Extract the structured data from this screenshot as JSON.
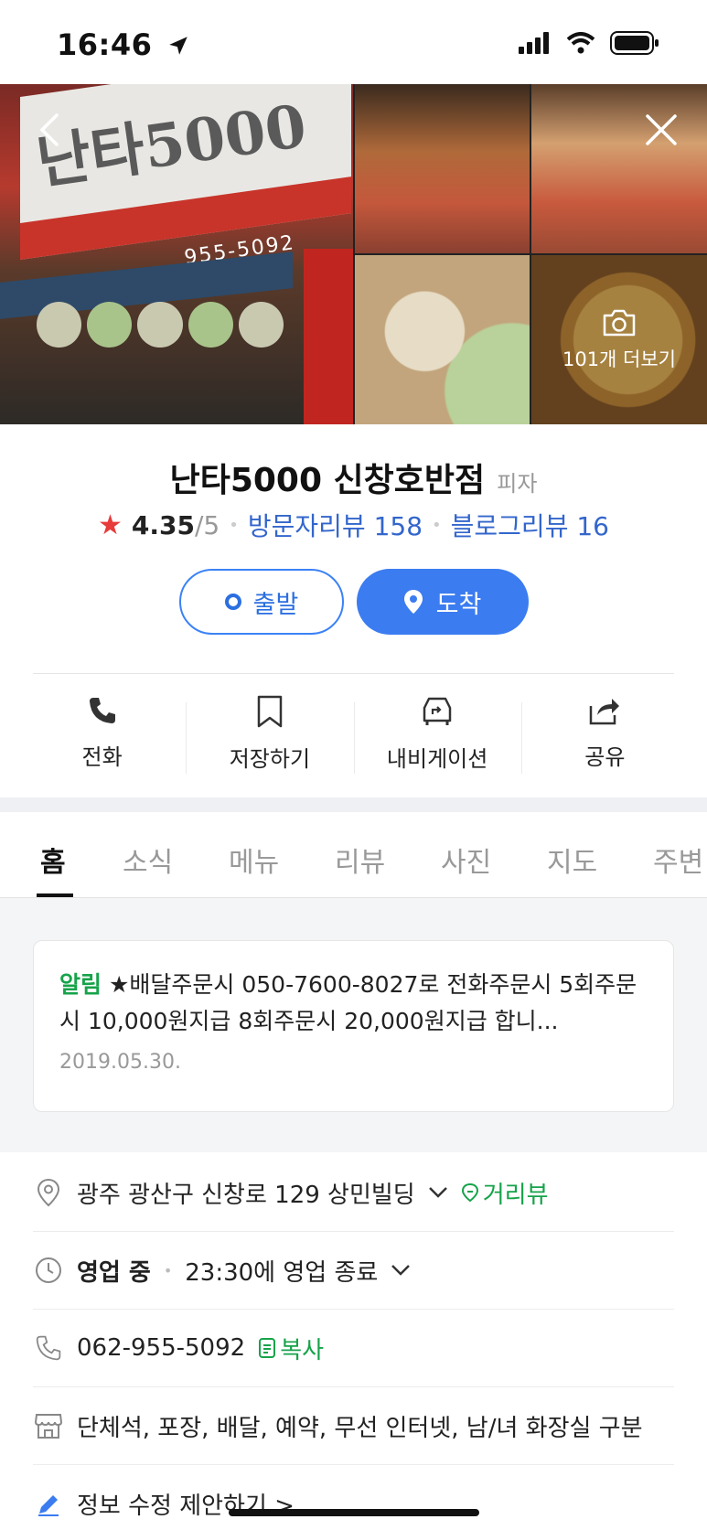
{
  "status": {
    "time": "16:46"
  },
  "photos": {
    "more_label": "101개 더보기"
  },
  "place": {
    "name": "난타5000 신창호반점",
    "category": "피자",
    "rating": "4.35",
    "rating_max": "/5",
    "visitor_reviews": "방문자리뷰 158",
    "blog_reviews": "블로그리뷰 16"
  },
  "route": {
    "depart_label": "출발",
    "arrive_label": "도착"
  },
  "actions": [
    {
      "label": "전화",
      "icon": "phone-icon"
    },
    {
      "label": "저장하기",
      "icon": "bookmark-icon"
    },
    {
      "label": "내비게이션",
      "icon": "car-navigation-icon"
    },
    {
      "label": "공유",
      "icon": "share-icon"
    }
  ],
  "tabs": [
    "홈",
    "소식",
    "메뉴",
    "리뷰",
    "사진",
    "지도",
    "주변"
  ],
  "notice": {
    "tag": "알림",
    "text": "★배달주문시 050-7600-8027로 전화주문시 5회주문시 10,000원지급 8회주문시 20,000원지급 합니...",
    "date": "2019.05.30."
  },
  "info": {
    "address": "광주 광산구 신창로 129 상민빌딩",
    "street_view": "거리뷰",
    "status": "영업 중",
    "hours": "23:30에 영업 종료",
    "phone": "062-955-5092",
    "copy": "복사",
    "amenities": "단체석, 포장, 배달, 예약, 무선 인터넷, 남/녀 화장실 구분",
    "edit": "정보 수정 제안하기 >"
  },
  "signage": {
    "brand": "난타5000",
    "phone": "955-5092"
  },
  "colors": {
    "accent_blue": "#3b7cf0",
    "green": "#16a34a",
    "star": "#e83b3b"
  }
}
